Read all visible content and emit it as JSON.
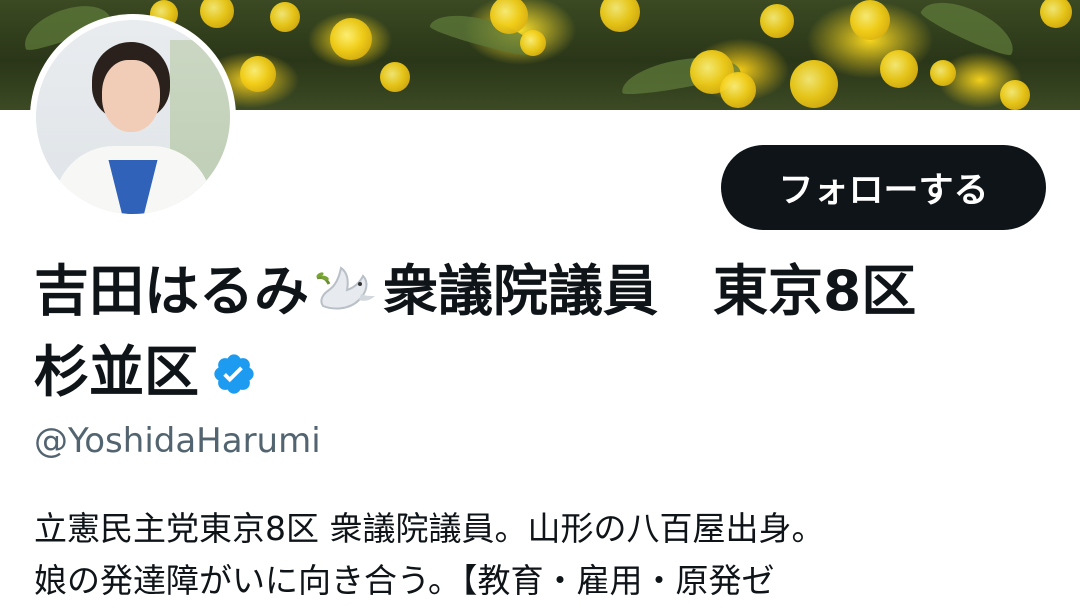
{
  "profile": {
    "name_part1": "吉田はるみ",
    "name_part2": "衆議院議員　東京8区",
    "name_part3": "杉並区",
    "handle": "@YoshidaHarumi",
    "bio_line1": "立憲民主党東京8区 衆議院議員。山形の八百屋出身。",
    "bio_line2": "娘の発達障がいに向き合う。【教育・雇用・原発ゼ"
  },
  "follow_button": {
    "label": "フォローする"
  },
  "icons": {
    "dove": "dove-emoji-icon",
    "verified": "verified-badge-icon"
  },
  "colors": {
    "text_primary": "#0f1419",
    "text_secondary": "#536471",
    "button_bg": "#0f1419",
    "verified_blue": "#1d9bf0"
  }
}
